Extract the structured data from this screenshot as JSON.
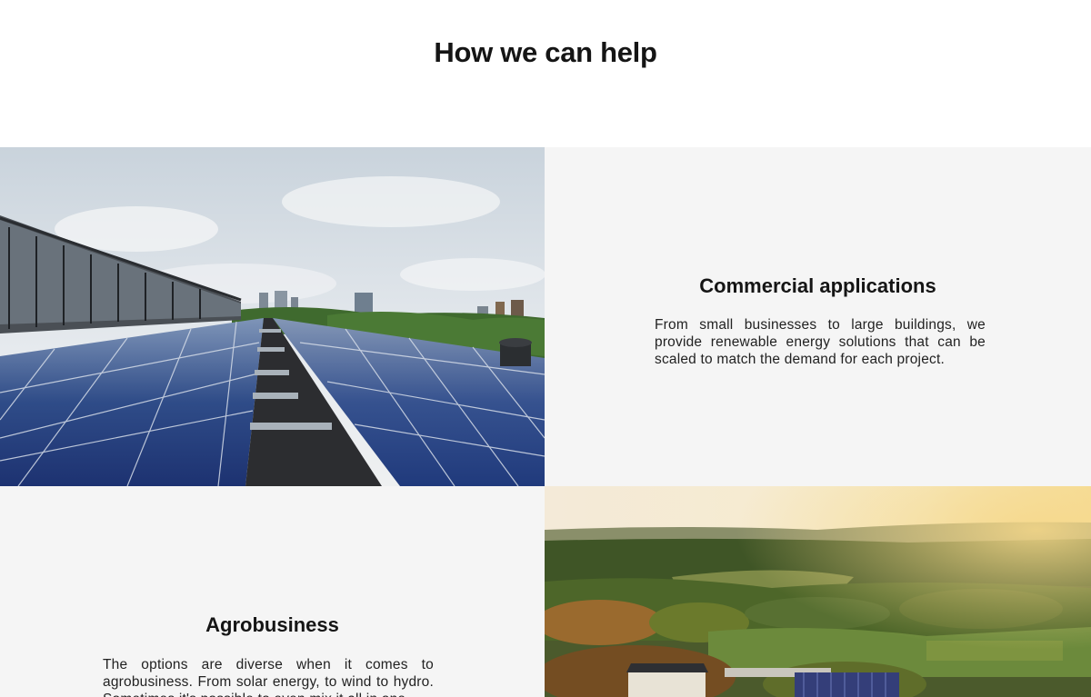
{
  "section": {
    "title": "How we can help"
  },
  "cards": {
    "commercial": {
      "title": "Commercial applications",
      "body": "From small businesses to large buildings, we provide renewable energy solutions that can be scaled to match the demand for each project.",
      "image": "rooftop-solar-panels-photo"
    },
    "agro": {
      "title": "Agrobusiness",
      "body": "The options are diverse when it comes to agrobusiness. From solar energy, to wind to hydro. Sometimes it's possible to even mix it all in one.",
      "image": "farmland-sunset-aerial-photo"
    }
  },
  "colors": {
    "panel_background": "#f5f5f5",
    "heading": "#151515"
  }
}
